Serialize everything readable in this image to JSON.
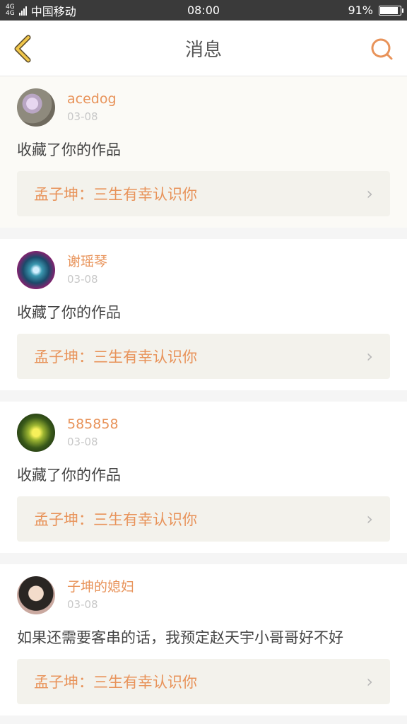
{
  "status_bar": {
    "signal_label": "4G",
    "carrier": "中国移动",
    "time": "08:00",
    "battery": "91%",
    "battery_level": 0.91
  },
  "header": {
    "title": "消息",
    "back_icon": "chevron-left-icon",
    "search_icon": "search-icon"
  },
  "messages": [
    {
      "username": "acedog",
      "date": "03-08",
      "comment": "收藏了你的作品",
      "work": "孟子坤：三生有幸认识你"
    },
    {
      "username": "谢瑶琴",
      "date": "03-08",
      "comment": "收藏了你的作品",
      "work": "孟子坤：三生有幸认识你"
    },
    {
      "username": "585858",
      "date": "03-08",
      "comment": "收藏了你的作品",
      "work": "孟子坤：三生有幸认识你"
    },
    {
      "username": "子坤的媳妇",
      "date": "03-08",
      "comment": "如果还需要客串的话，我预定赵天宇小哥哥好不好",
      "work": "孟子坤：三生有幸认识你"
    }
  ],
  "colors": {
    "accent": "#e8935a",
    "back_icon": "#e2b43a",
    "status_bar": "#3a3a3a"
  }
}
